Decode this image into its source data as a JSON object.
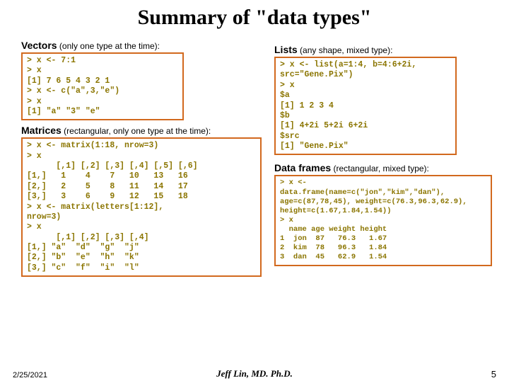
{
  "title": "Summary of \"data types\"",
  "sections": {
    "vectors": {
      "bold": "Vectors",
      "light": " (only one type at the time):"
    },
    "matrices": {
      "bold": "Matrices",
      "light": " (rectangular, only one type at the time):"
    },
    "lists": {
      "bold": "Lists",
      "light": " (any shape, mixed type):"
    },
    "dataframes": {
      "bold": "Data frames",
      "light": " (rectangular, mixed type):"
    }
  },
  "code": {
    "vectors": "> x <- 7:1\n> x\n[1] 7 6 5 4 3 2 1\n> x <- c(\"a\",3,\"e\")\n> x\n[1] \"a\" \"3\" \"e\"",
    "matrices": "> x <- matrix(1:18, nrow=3)\n> x\n      [,1] [,2] [,3] [,4] [,5] [,6]\n[1,]   1    4    7   10   13   16\n[2,]   2    5    8   11   14   17\n[3,]   3    6    9   12   15   18\n> x <- matrix(letters[1:12],\nnrow=3)\n> x\n      [,1] [,2] [,3] [,4]\n[1,] \"a\"  \"d\"  \"g\"  \"j\"\n[2,] \"b\"  \"e\"  \"h\"  \"k\"\n[3,] \"c\"  \"f\"  \"i\"  \"l\"",
    "lists": "> x <- list(a=1:4, b=4:6+2i,\nsrc=\"Gene.Pix\")\n> x\n$a\n[1] 1 2 3 4\n$b\n[1] 4+2i 5+2i 6+2i\n$src\n[1] \"Gene.Pix\"",
    "dataframes": "> x <-\ndata.frame(name=c(\"jon\",\"kim\",\"dan\"),\nage=c(87,78,45), weight=c(76.3,96.3,62.9),\nheight=c(1.67,1.84,1.54))\n> x\n  name age weight height\n1  jon  87   76.3   1.67\n2  kim  78   96.3   1.84\n3  dan  45   62.9   1.54"
  },
  "footer": {
    "date": "2/25/2021",
    "author": "Jeff Lin, MD. Ph.D.",
    "page": "5"
  }
}
